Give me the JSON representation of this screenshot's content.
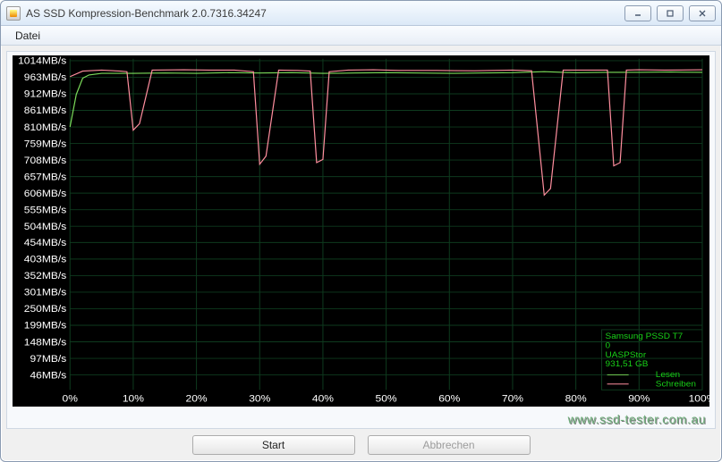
{
  "window": {
    "title": "AS SSD Kompression-Benchmark 2.0.7316.34247"
  },
  "menu": {
    "file": "Datei"
  },
  "buttons": {
    "start": "Start",
    "abort": "Abbrechen"
  },
  "legend": {
    "device": "Samsung PSSD T7",
    "subline": "0",
    "driver": "UASPStor",
    "capacity": "931,51 GB",
    "read": "Lesen",
    "write": "Schreiben"
  },
  "watermark": "www.ssd-tester.com.au",
  "chart_data": {
    "type": "line",
    "xlabel": "",
    "ylabel": "",
    "x_unit": "%",
    "y_unit": "MB/s",
    "xlim": [
      0,
      100
    ],
    "ylim": [
      0,
      1020
    ],
    "x_ticks": [
      0,
      10,
      20,
      30,
      40,
      50,
      60,
      70,
      80,
      90,
      100
    ],
    "y_ticks": [
      46,
      97,
      148,
      199,
      250,
      301,
      352,
      403,
      454,
      504,
      555,
      606,
      657,
      708,
      759,
      810,
      861,
      912,
      963,
      1014
    ],
    "y_tick_labels": [
      "46MB/s",
      "97MB/s",
      "148MB/s",
      "199MB/s",
      "250MB/s",
      "301MB/s",
      "352MB/s",
      "403MB/s",
      "454MB/s",
      "504MB/s",
      "555MB/s",
      "606MB/s",
      "657MB/s",
      "708MB/s",
      "759MB/s",
      "810MB/s",
      "861MB/s",
      "912MB/s",
      "963MB/s",
      "1014MB/s"
    ],
    "series": [
      {
        "name": "Lesen",
        "color": "#7bdc5a",
        "x": [
          0,
          1,
          2,
          3,
          5,
          8,
          10,
          15,
          20,
          25,
          30,
          35,
          40,
          45,
          50,
          55,
          60,
          65,
          70,
          75,
          80,
          85,
          90,
          95,
          100
        ],
        "y": [
          810,
          910,
          960,
          970,
          975,
          975,
          975,
          976,
          975,
          977,
          976,
          977,
          975,
          976,
          977,
          976,
          975,
          976,
          977,
          980,
          977,
          978,
          978,
          979,
          978
        ]
      },
      {
        "name": "Schreiben",
        "color": "#ff8e9e",
        "x": [
          0,
          2,
          5,
          8,
          9,
          10,
          11,
          13,
          18,
          22,
          26,
          29,
          30,
          31,
          33,
          36,
          38,
          39,
          40,
          41,
          44,
          48,
          52,
          58,
          64,
          70,
          73,
          75,
          76,
          78,
          82,
          85,
          86,
          87,
          88,
          90,
          94,
          100
        ],
        "y": [
          965,
          982,
          985,
          982,
          980,
          800,
          820,
          985,
          986,
          985,
          985,
          980,
          695,
          720,
          985,
          984,
          982,
          700,
          710,
          980,
          985,
          986,
          984,
          984,
          983,
          985,
          983,
          600,
          620,
          985,
          985,
          985,
          690,
          700,
          985,
          986,
          985,
          986
        ]
      }
    ]
  }
}
